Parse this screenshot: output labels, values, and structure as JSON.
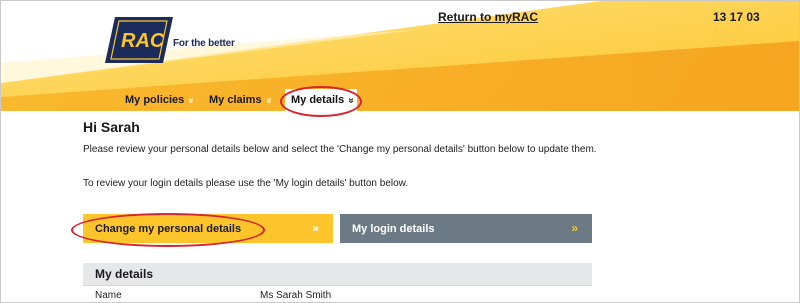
{
  "header": {
    "brand": "RAC",
    "tagline": "For the better",
    "return_link": "Return to myRAC",
    "phone": "13 17 03"
  },
  "nav": {
    "items": [
      {
        "label": "My policies",
        "active": false
      },
      {
        "label": "My claims",
        "active": false
      },
      {
        "label": "My details",
        "active": true
      }
    ],
    "chevron": "»"
  },
  "main": {
    "greeting": "Hi Sarah",
    "intro_paragraph": "Please review your personal details below and select the 'Change my personal details' button below to update them.",
    "login_paragraph": "To review your login details please use the 'My login details' button below.",
    "buttons": {
      "change_personal": "Change my personal details",
      "login_details": "My login details",
      "chevron": "»"
    },
    "details": {
      "heading": "My details",
      "rows": [
        {
          "label": "Name",
          "value": "Ms Sarah Smith"
        }
      ]
    }
  },
  "colors": {
    "brand_yellow": "#fdc52b",
    "brand_orange": "#f7a823",
    "brand_navy": "#1a2b5c",
    "login_button_gray": "#6b7a84",
    "annotation_red": "#d9232e"
  },
  "icons": {
    "nav_chevron": "double-chevron-down-icon",
    "button_chevron": "double-chevron-right-icon"
  }
}
